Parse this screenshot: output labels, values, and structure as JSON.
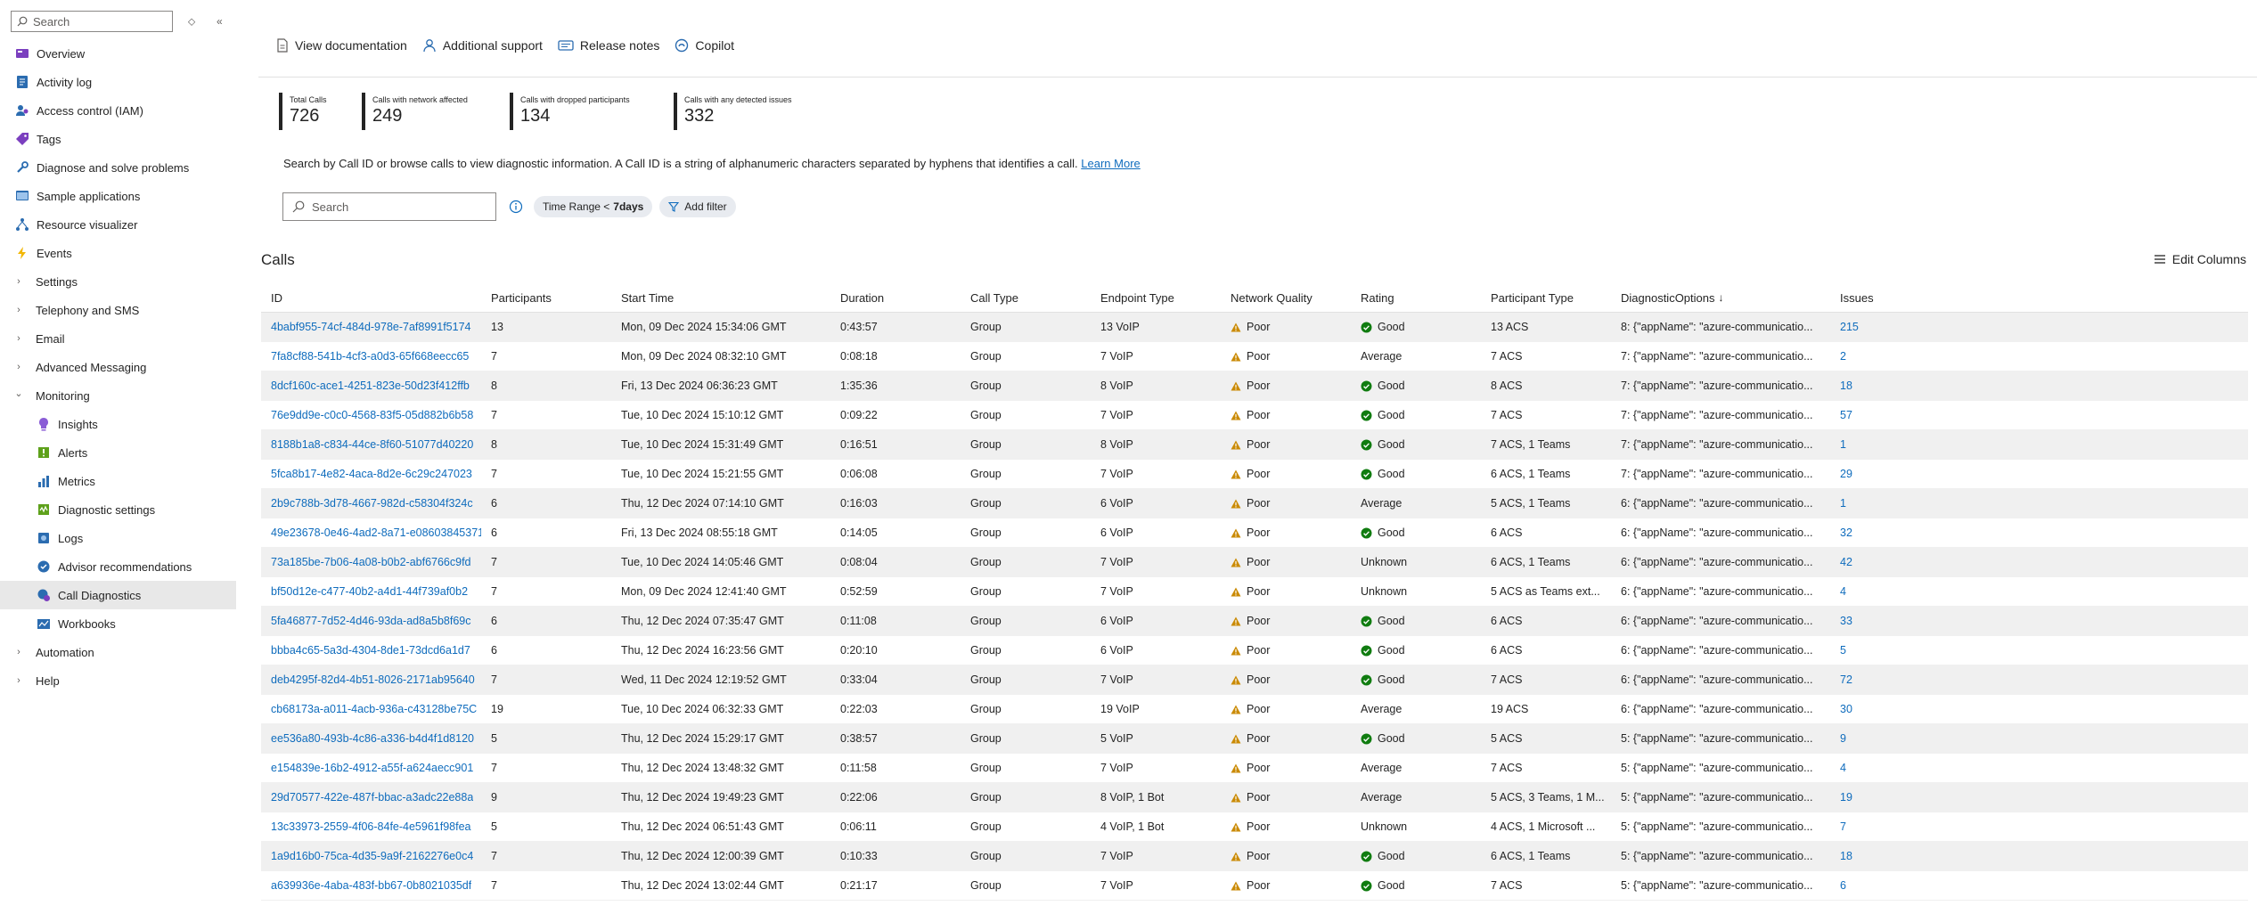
{
  "sidebar": {
    "search_placeholder": "Search",
    "items": [
      {
        "label": "Overview",
        "icon": "overview-icon"
      },
      {
        "label": "Activity log",
        "icon": "activity-log-icon"
      },
      {
        "label": "Access control (IAM)",
        "icon": "iam-icon"
      },
      {
        "label": "Tags",
        "icon": "tag-icon"
      },
      {
        "label": "Diagnose and solve problems",
        "icon": "wrench-icon"
      },
      {
        "label": "Sample applications",
        "icon": "sample-apps-icon"
      },
      {
        "label": "Resource visualizer",
        "icon": "resource-visualizer-icon"
      },
      {
        "label": "Events",
        "icon": "lightning-icon"
      },
      {
        "label": "Settings",
        "icon": "chevron-right-icon"
      },
      {
        "label": "Telephony and SMS",
        "icon": "chevron-right-icon"
      },
      {
        "label": "Email",
        "icon": "chevron-right-icon"
      },
      {
        "label": "Advanced Messaging",
        "icon": "chevron-right-icon"
      },
      {
        "label": "Monitoring",
        "icon": "chevron-down-icon"
      },
      {
        "label": "Insights",
        "icon": "insights-icon"
      },
      {
        "label": "Alerts",
        "icon": "alerts-icon"
      },
      {
        "label": "Metrics",
        "icon": "metrics-icon"
      },
      {
        "label": "Diagnostic settings",
        "icon": "diagnostic-settings-icon"
      },
      {
        "label": "Logs",
        "icon": "logs-icon"
      },
      {
        "label": "Advisor recommendations",
        "icon": "advisor-icon"
      },
      {
        "label": "Call Diagnostics",
        "icon": "call-diagnostics-icon"
      },
      {
        "label": "Workbooks",
        "icon": "workbooks-icon"
      },
      {
        "label": "Automation",
        "icon": "chevron-right-icon"
      },
      {
        "label": "Help",
        "icon": "chevron-right-icon"
      }
    ]
  },
  "toolbar": {
    "view_docs": "View documentation",
    "additional_support": "Additional support",
    "release_notes": "Release notes",
    "copilot": "Copilot"
  },
  "stats": [
    {
      "label": "Total Calls",
      "value": "726"
    },
    {
      "label": "Calls with network affected",
      "value": "249"
    },
    {
      "label": "Calls with dropped participants",
      "value": "134"
    },
    {
      "label": "Calls with any detected issues",
      "value": "332"
    }
  ],
  "description": {
    "text": "Search by Call ID or browse calls to view diagnostic information. A Call ID is a string of alphanumeric characters separated by hyphens that identifies a call.",
    "link": "Learn More"
  },
  "filters": {
    "search_placeholder": "Search",
    "time_range_label": "Time Range <",
    "time_range_value": "7days",
    "add_filter": "Add filter"
  },
  "calls": {
    "title": "Calls",
    "edit_columns": "Edit Columns",
    "headers": {
      "id": "ID",
      "participants": "Participants",
      "start": "Start Time",
      "duration": "Duration",
      "call_type": "Call Type",
      "endpoint": "Endpoint Type",
      "network": "Network Quality",
      "rating": "Rating",
      "participant_type": "Participant Type",
      "diag": "DiagnosticOptions",
      "issues": "Issues"
    },
    "rows": [
      {
        "id": "4babf955-74cf-484d-978e-7af8991f5174",
        "participants": "13",
        "start": "Mon, 09 Dec 2024 15:34:06 GMT",
        "duration": "0:43:57",
        "call_type": "Group",
        "endpoint": "13 VoIP",
        "network": "Poor",
        "rating": "Good",
        "participant_type": "13 ACS",
        "diag": "8: {\"appName\": \"azure-communicatio...",
        "issues": "215"
      },
      {
        "id": "7fa8cf88-541b-4cf3-a0d3-65f668eecc65",
        "participants": "7",
        "start": "Mon, 09 Dec 2024 08:32:10 GMT",
        "duration": "0:08:18",
        "call_type": "Group",
        "endpoint": "7 VoIP",
        "network": "Poor",
        "rating": "Average",
        "participant_type": "7 ACS",
        "diag": "7: {\"appName\": \"azure-communicatio...",
        "issues": "2"
      },
      {
        "id": "8dcf160c-ace1-4251-823e-50d23f412ffb",
        "participants": "8",
        "start": "Fri, 13 Dec 2024 06:36:23 GMT",
        "duration": "1:35:36",
        "call_type": "Group",
        "endpoint": "8 VoIP",
        "network": "Poor",
        "rating": "Good",
        "participant_type": "8 ACS",
        "diag": "7: {\"appName\": \"azure-communicatio...",
        "issues": "18"
      },
      {
        "id": "76e9dd9e-c0c0-4568-83f5-05d882b6b58",
        "participants": "7",
        "start": "Tue, 10 Dec 2024 15:10:12 GMT",
        "duration": "0:09:22",
        "call_type": "Group",
        "endpoint": "7 VoIP",
        "network": "Poor",
        "rating": "Good",
        "participant_type": "7 ACS",
        "diag": "7: {\"appName\": \"azure-communicatio...",
        "issues": "57"
      },
      {
        "id": "8188b1a8-c834-44ce-8f60-51077d40220",
        "participants": "8",
        "start": "Tue, 10 Dec 2024 15:31:49 GMT",
        "duration": "0:16:51",
        "call_type": "Group",
        "endpoint": "8 VoIP",
        "network": "Poor",
        "rating": "Good",
        "participant_type": "7 ACS, 1 Teams",
        "diag": "7: {\"appName\": \"azure-communicatio...",
        "issues": "1"
      },
      {
        "id": "5fca8b17-4e82-4aca-8d2e-6c29c247023",
        "participants": "7",
        "start": "Tue, 10 Dec 2024 15:21:55 GMT",
        "duration": "0:06:08",
        "call_type": "Group",
        "endpoint": "7 VoIP",
        "network": "Poor",
        "rating": "Good",
        "participant_type": "6 ACS, 1 Teams",
        "diag": "7: {\"appName\": \"azure-communicatio...",
        "issues": "29"
      },
      {
        "id": "2b9c788b-3d78-4667-982d-c58304f324c",
        "participants": "6",
        "start": "Thu, 12 Dec 2024 07:14:10 GMT",
        "duration": "0:16:03",
        "call_type": "Group",
        "endpoint": "6 VoIP",
        "network": "Poor",
        "rating": "Average",
        "participant_type": "5 ACS, 1 Teams",
        "diag": "6: {\"appName\": \"azure-communicatio...",
        "issues": "1"
      },
      {
        "id": "49e23678-0e46-4ad2-8a71-e08603845371",
        "participants": "6",
        "start": "Fri, 13 Dec 2024 08:55:18 GMT",
        "duration": "0:14:05",
        "call_type": "Group",
        "endpoint": "6 VoIP",
        "network": "Poor",
        "rating": "Good",
        "participant_type": "6 ACS",
        "diag": "6: {\"appName\": \"azure-communicatio...",
        "issues": "32"
      },
      {
        "id": "73a185be-7b06-4a08-b0b2-abf6766c9fd",
        "participants": "7",
        "start": "Tue, 10 Dec 2024 14:05:46 GMT",
        "duration": "0:08:04",
        "call_type": "Group",
        "endpoint": "7 VoIP",
        "network": "Poor",
        "rating": "Unknown",
        "participant_type": "6 ACS, 1 Teams",
        "diag": "6: {\"appName\": \"azure-communicatio...",
        "issues": "42"
      },
      {
        "id": "bf50d12e-c477-40b2-a4d1-44f739af0b2",
        "participants": "7",
        "start": "Mon, 09 Dec 2024 12:41:40 GMT",
        "duration": "0:52:59",
        "call_type": "Group",
        "endpoint": "7 VoIP",
        "network": "Poor",
        "rating": "Unknown",
        "participant_type": "5 ACS as Teams ext...",
        "diag": "6: {\"appName\": \"azure-communicatio...",
        "issues": "4"
      },
      {
        "id": "5fa46877-7d52-4d46-93da-ad8a5b8f69c",
        "participants": "6",
        "start": "Thu, 12 Dec 2024 07:35:47 GMT",
        "duration": "0:11:08",
        "call_type": "Group",
        "endpoint": "6 VoIP",
        "network": "Poor",
        "rating": "Good",
        "participant_type": "6 ACS",
        "diag": "6: {\"appName\": \"azure-communicatio...",
        "issues": "33"
      },
      {
        "id": "bbba4c65-5a3d-4304-8de1-73dcd6a1d7",
        "participants": "6",
        "start": "Thu, 12 Dec 2024 16:23:56 GMT",
        "duration": "0:20:10",
        "call_type": "Group",
        "endpoint": "6 VoIP",
        "network": "Poor",
        "rating": "Good",
        "participant_type": "6 ACS",
        "diag": "6: {\"appName\": \"azure-communicatio...",
        "issues": "5"
      },
      {
        "id": "deb4295f-82d4-4b51-8026-2171ab95640",
        "participants": "7",
        "start": "Wed, 11 Dec 2024 12:19:52 GMT",
        "duration": "0:33:04",
        "call_type": "Group",
        "endpoint": "7 VoIP",
        "network": "Poor",
        "rating": "Good",
        "participant_type": "7 ACS",
        "diag": "6: {\"appName\": \"azure-communicatio...",
        "issues": "72"
      },
      {
        "id": "cb68173a-a011-4acb-936a-c43128be75C",
        "participants": "19",
        "start": "Tue, 10 Dec 2024 06:32:33 GMT",
        "duration": "0:22:03",
        "call_type": "Group",
        "endpoint": "19 VoIP",
        "network": "Poor",
        "rating": "Average",
        "participant_type": "19 ACS",
        "diag": "6: {\"appName\": \"azure-communicatio...",
        "issues": "30"
      },
      {
        "id": "ee536a80-493b-4c86-a336-b4d4f1d8120",
        "participants": "5",
        "start": "Thu, 12 Dec 2024 15:29:17 GMT",
        "duration": "0:38:57",
        "call_type": "Group",
        "endpoint": "5 VoIP",
        "network": "Poor",
        "rating": "Good",
        "participant_type": "5 ACS",
        "diag": "5: {\"appName\": \"azure-communicatio...",
        "issues": "9"
      },
      {
        "id": "e154839e-16b2-4912-a55f-a624aecc901",
        "participants": "7",
        "start": "Thu, 12 Dec 2024 13:48:32 GMT",
        "duration": "0:11:58",
        "call_type": "Group",
        "endpoint": "7 VoIP",
        "network": "Poor",
        "rating": "Average",
        "participant_type": "7 ACS",
        "diag": "5: {\"appName\": \"azure-communicatio...",
        "issues": "4"
      },
      {
        "id": "29d70577-422e-487f-bbac-a3adc22e88a",
        "participants": "9",
        "start": "Thu, 12 Dec 2024 19:49:23 GMT",
        "duration": "0:22:06",
        "call_type": "Group",
        "endpoint": "8 VoIP, 1 Bot",
        "network": "Poor",
        "rating": "Average",
        "participant_type": "5 ACS, 3 Teams, 1 M...",
        "diag": "5: {\"appName\": \"azure-communicatio...",
        "issues": "19"
      },
      {
        "id": "13c33973-2559-4f06-84fe-4e5961f98fea",
        "participants": "5",
        "start": "Thu, 12 Dec 2024 06:51:43 GMT",
        "duration": "0:06:11",
        "call_type": "Group",
        "endpoint": "4 VoIP, 1 Bot",
        "network": "Poor",
        "rating": "Unknown",
        "participant_type": "4 ACS, 1 Microsoft ...",
        "diag": "5: {\"appName\": \"azure-communicatio...",
        "issues": "7"
      },
      {
        "id": "1a9d16b0-75ca-4d35-9a9f-2162276e0c4",
        "participants": "7",
        "start": "Thu, 12 Dec 2024 12:00:39 GMT",
        "duration": "0:10:33",
        "call_type": "Group",
        "endpoint": "7 VoIP",
        "network": "Poor",
        "rating": "Good",
        "participant_type": "6 ACS, 1 Teams",
        "diag": "5: {\"appName\": \"azure-communicatio...",
        "issues": "18"
      },
      {
        "id": "a639936e-4aba-483f-bb67-0b8021035df",
        "participants": "7",
        "start": "Thu, 12 Dec 2024 13:02:44 GMT",
        "duration": "0:21:17",
        "call_type": "Group",
        "endpoint": "7 VoIP",
        "network": "Poor",
        "rating": "Good",
        "participant_type": "7 ACS",
        "diag": "5: {\"appName\": \"azure-communicatio...",
        "issues": "6"
      }
    ]
  },
  "colors": {
    "link": "#0f6cbd",
    "warning": "#ca8a04",
    "good": "#107c10",
    "selected_bg": "#e8e8e8"
  }
}
